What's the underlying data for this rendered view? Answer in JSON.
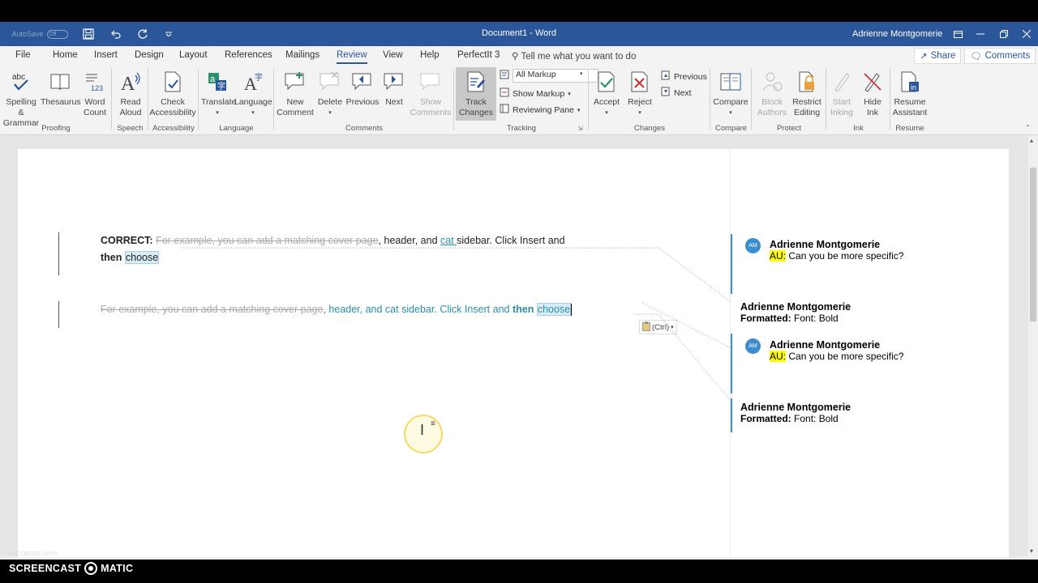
{
  "titlebar": {
    "autosave_label": "AutoSave",
    "autosave_state": "Off",
    "title": "Document1  -  Word",
    "user": "Adrienne Montgomerie"
  },
  "menu": {
    "tabs": [
      "File",
      "Home",
      "Insert",
      "Design",
      "Layout",
      "References",
      "Mailings",
      "Review",
      "View",
      "Help",
      "PerfectIt 3"
    ],
    "active_tab": "Review",
    "tell_me": "Tell me what you want to do",
    "share": "Share",
    "comments": "Comments"
  },
  "ribbon": {
    "buttons": {
      "spelling": "Spelling &\nGrammar",
      "thesaurus": "Thesaurus",
      "word_count": "Word\nCount",
      "read_aloud": "Read\nAloud",
      "check_access": "Check\nAccessibility",
      "translate": "Translate",
      "language": "Language",
      "new_comment": "New\nComment",
      "delete": "Delete",
      "previous": "Previous",
      "next": "Next",
      "show_comments": "Show\nComments",
      "track_changes": "Track\nChanges",
      "accept": "Accept",
      "reject": "Reject",
      "prev_change": "Previous",
      "next_change": "Next",
      "compare": "Compare",
      "block_authors": "Block\nAuthors",
      "restrict": "Restrict\nEditing",
      "start_inking": "Start\nInking",
      "hide_ink": "Hide\nInk",
      "resume": "Resume\nAssistant"
    },
    "markup_select": "All Markup",
    "show_markup": "Show Markup",
    "reviewing_pane": "Reviewing Pane",
    "groups": {
      "proofing": "Proofing",
      "speech": "Speech",
      "accessibility": "Accessibility",
      "language": "Language",
      "comments": "Comments",
      "tracking": "Tracking",
      "changes": "Changes",
      "compare": "Compare",
      "protect": "Protect",
      "ink": "Ink",
      "resume": "Resume"
    }
  },
  "document": {
    "para1": {
      "correct": "CORRECT:",
      "deleted": "For example, you can add a matching cover page",
      "text1": ", header, and ",
      "inserted": "cat ",
      "text2": "sidebar. Click Insert and",
      "then": "then",
      "choose": "choose"
    },
    "para2": {
      "deleted": "For example, you can add a matching cover page",
      "inserted": ", header, and cat sidebar. Click Insert and ",
      "then": "then",
      "choose": "choose"
    },
    "paste_options": "(Ctrl)"
  },
  "comments": [
    {
      "initials": "AM",
      "author": "Adrienne Montgomerie",
      "tag": "AU:",
      "text": "Can you be more specific?"
    },
    {
      "author": "Adrienne Montgomerie",
      "label": "Formatted:",
      "text": "Font: Bold"
    },
    {
      "initials": "AM",
      "author": "Adrienne Montgomerie",
      "tag": "AU:",
      "text": "Can you be more specific?"
    },
    {
      "author": "Adrienne Montgomerie",
      "label": "Formatted:",
      "text": "Font: Bold"
    }
  ],
  "watermark": {
    "recorded": "RECORDED WITH",
    "brand1": "SCREENCAST",
    "brand2": "MATIC"
  },
  "colors": {
    "word_blue": "#2b579a",
    "insert_teal": "#2a8fa5",
    "comment_blue": "#3a8fc7",
    "highlight": "#ffff00"
  }
}
